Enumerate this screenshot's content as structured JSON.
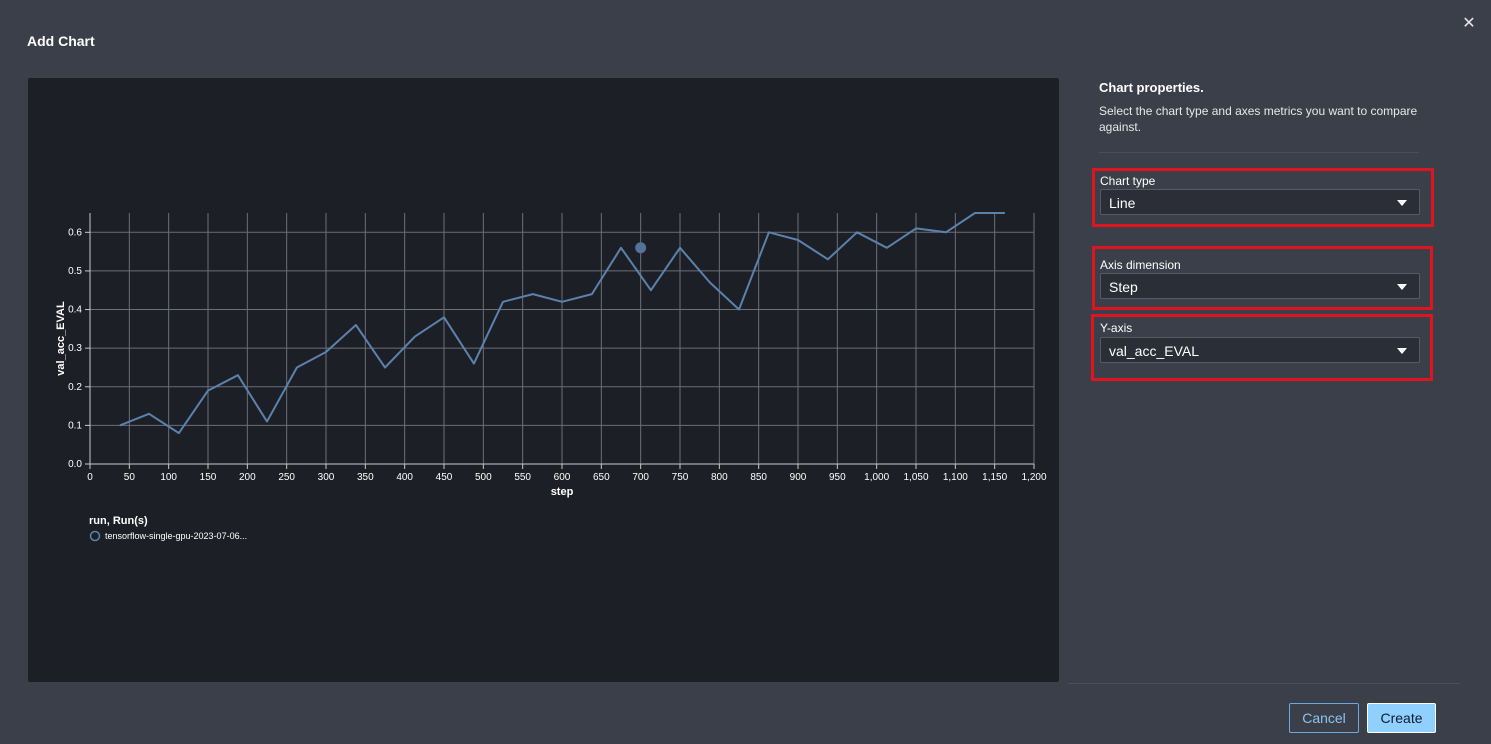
{
  "dialog": {
    "title": "Add Chart",
    "close_label": "✕"
  },
  "properties": {
    "heading": "Chart properties.",
    "description": "Select the chart type and axes metrics you want to compare against.",
    "chart_type": {
      "label": "Chart type",
      "value": "Line"
    },
    "axis_dimension": {
      "label": "Axis dimension",
      "value": "Step"
    },
    "y_axis": {
      "label": "Y-axis",
      "value": "val_acc_EVAL"
    },
    "highlight_color": "#e0141e"
  },
  "footer": {
    "cancel_label": "Cancel",
    "create_label": "Create"
  },
  "chart_data": {
    "type": "line",
    "xlabel": "step",
    "ylabel": "val_acc_EVAL",
    "xlim": [
      0,
      1200
    ],
    "ylim": [
      0,
      0.65
    ],
    "x_ticks": [
      0,
      50,
      100,
      150,
      200,
      250,
      300,
      350,
      400,
      450,
      500,
      550,
      600,
      650,
      700,
      750,
      800,
      850,
      900,
      950,
      1000,
      1050,
      1100,
      1150,
      1200
    ],
    "x_tick_labels": [
      "0",
      "50",
      "100",
      "150",
      "200",
      "250",
      "300",
      "350",
      "400",
      "450",
      "500",
      "550",
      "600",
      "650",
      "700",
      "750",
      "800",
      "850",
      "900",
      "950",
      "1,000",
      "1,050",
      "1,100",
      "1,150",
      "1,200"
    ],
    "y_ticks": [
      0,
      0.1,
      0.2,
      0.3,
      0.4,
      0.5,
      0.6
    ],
    "y_tick_labels": [
      "0.0",
      "0.1",
      "0.2",
      "0.3",
      "0.4",
      "0.5",
      "0.6"
    ],
    "grid": true,
    "series_color": "#5b82ad",
    "legend": {
      "title": "run, Run(s)",
      "entries": [
        "tensorflow-single-gpu-2023-07-06..."
      ]
    },
    "highlighted_point": {
      "x": 700,
      "y": 0.56
    },
    "series": [
      {
        "name": "tensorflow-single-gpu-2023-07-06...",
        "x": [
          38,
          75,
          113,
          150,
          188,
          225,
          263,
          300,
          338,
          375,
          413,
          450,
          488,
          525,
          563,
          600,
          638,
          675,
          713,
          750,
          788,
          825,
          863,
          900,
          938,
          975,
          1013,
          1050,
          1088,
          1125,
          1163
        ],
        "values": [
          0.1,
          0.13,
          0.08,
          0.19,
          0.23,
          0.11,
          0.25,
          0.29,
          0.36,
          0.25,
          0.33,
          0.38,
          0.26,
          0.42,
          0.44,
          0.42,
          0.44,
          0.56,
          0.45,
          0.56,
          0.47,
          0.4,
          0.6,
          0.58,
          0.53,
          0.6,
          0.56,
          0.61,
          0.6,
          0.65,
          0.65
        ]
      }
    ]
  }
}
